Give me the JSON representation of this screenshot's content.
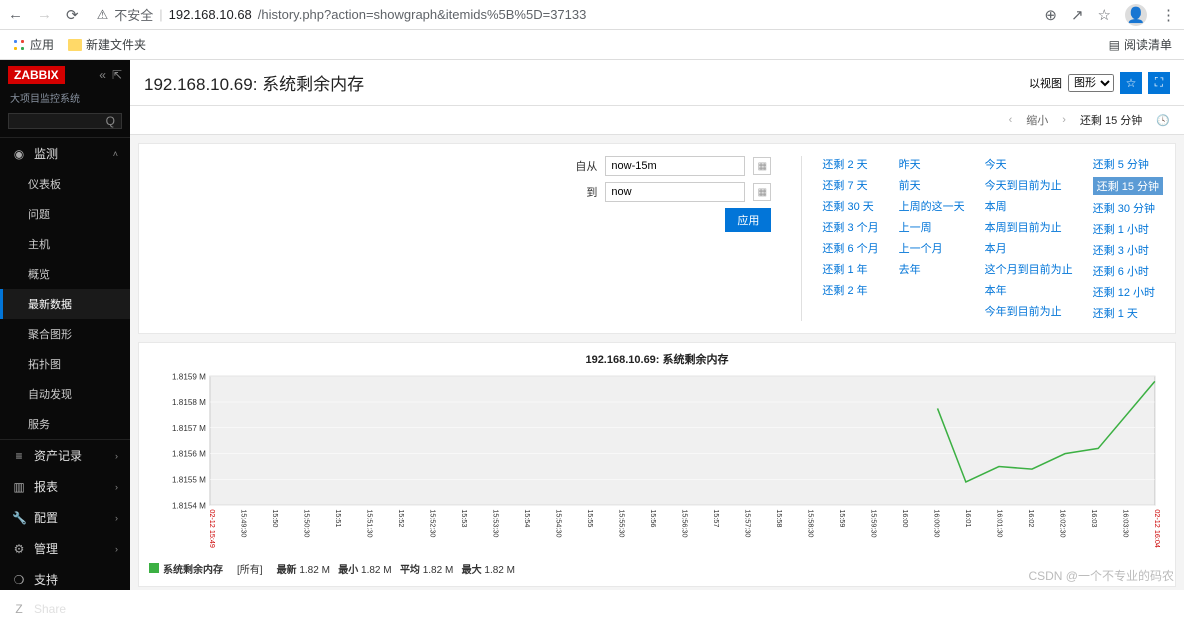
{
  "browser": {
    "security": "不安全",
    "url_host": "192.168.10.68",
    "url_path": "/history.php?action=showgraph&itemids%5B%5D=37133",
    "bookmarks": {
      "apps": "应用",
      "folder": "新建文件夹",
      "readlist": "阅读清单"
    }
  },
  "sidebar": {
    "logo": "ZABBIX",
    "subtitle": "大项目监控系统",
    "menu": {
      "monitoring": "监测",
      "sub": [
        "仪表板",
        "问题",
        "主机",
        "概览",
        "最新数据",
        "聚合图形",
        "拓扑图",
        "自动发现",
        "服务"
      ],
      "inventory": "资产记录",
      "reports": "报表",
      "config": "配置",
      "admin": "管理",
      "support": "支持",
      "share": "Share"
    }
  },
  "header": {
    "title": "192.168.10.69: 系统剩余内存",
    "view_label": "以视图",
    "view_value": "图形"
  },
  "timenav": {
    "zoomout": "缩小",
    "range": "还剩 15 分钟"
  },
  "filter": {
    "from_label": "自从",
    "from_value": "now-15m",
    "to_label": "到",
    "to_value": "now",
    "apply": "应用"
  },
  "quick": {
    "col1": [
      "还剩 2 天",
      "还剩 7 天",
      "还剩 30 天",
      "还剩 3 个月",
      "还剩 6 个月",
      "还剩 1 年",
      "还剩 2 年"
    ],
    "col2": [
      "昨天",
      "前天",
      "上周的这一天",
      "上一周",
      "上一个月",
      "去年"
    ],
    "col3": [
      "今天",
      "今天到目前为止",
      "本周",
      "本周到目前为止",
      "本月",
      "这个月到目前为止",
      "本年",
      "今年到目前为止"
    ],
    "col4": [
      "还剩 5 分钟",
      "还剩 15 分钟",
      "还剩 30 分钟",
      "还剩 1 小时",
      "还剩 3 小时",
      "还剩 6 小时",
      "还剩 12 小时",
      "还剩 1 天"
    ],
    "selected": "还剩 15 分钟"
  },
  "chart_data": {
    "type": "line",
    "title": "192.168.10.69: 系统剩余内存",
    "ylabel": "M",
    "y_ticks": [
      "1.8154 M",
      "1.8155 M",
      "1.8156 M",
      "1.8157 M",
      "1.8158 M",
      "1.8159 M"
    ],
    "x_ticks": [
      "02-12 15:49",
      "15:49:30",
      "15:50",
      "15:50:30",
      "15:51",
      "15:51:30",
      "15:52",
      "15:52:30",
      "15:53",
      "15:53:30",
      "15:54",
      "15:54:30",
      "15:55",
      "15:55:30",
      "15:56",
      "15:56:30",
      "15:57",
      "15:57:30",
      "15:58",
      "15:58:30",
      "15:59",
      "15:59:30",
      "16:00",
      "16:00:30",
      "16:01",
      "16:01:30",
      "16:02",
      "16:02:30",
      "16:03",
      "16:03:30",
      "02-12 16:04"
    ],
    "series": [
      {
        "name": "系统剩余内存",
        "color": "#3cb043",
        "points": [
          [
            0.77,
            0.25
          ],
          [
            0.8,
            0.82
          ],
          [
            0.835,
            0.7
          ],
          [
            0.87,
            0.72
          ],
          [
            0.905,
            0.6
          ],
          [
            0.94,
            0.56
          ],
          [
            1.0,
            0.04
          ]
        ]
      }
    ]
  },
  "legend": {
    "name": "系统剩余内存",
    "scope": "[所有]",
    "cols": [
      "最新",
      "最小",
      "平均",
      "最大"
    ],
    "vals": [
      "1.82 M",
      "1.82 M",
      "1.82 M",
      "1.82 M"
    ]
  },
  "watermark": "CSDN @一个不专业的码农"
}
